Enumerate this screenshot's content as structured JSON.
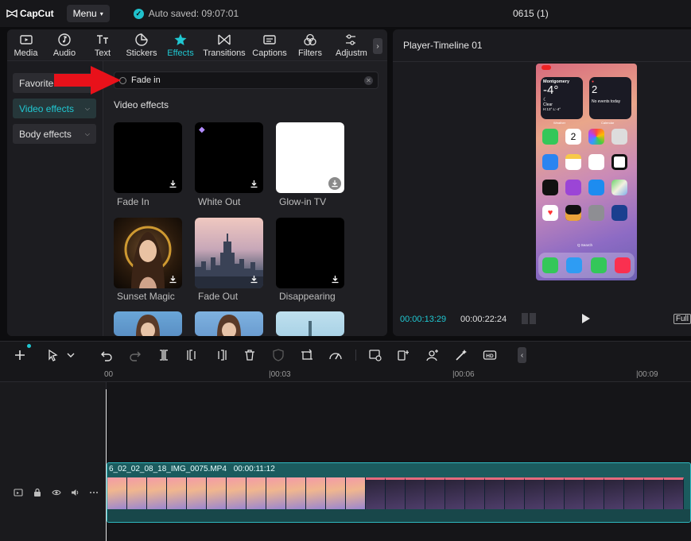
{
  "titlebar": {
    "app_name": "CapCut",
    "menu_label": "Menu",
    "autosave_text": "Auto saved: 09:07:01",
    "project_title": "0615 (1)"
  },
  "tabs": [
    {
      "label": "Media",
      "icon": "media-icon"
    },
    {
      "label": "Audio",
      "icon": "audio-icon"
    },
    {
      "label": "Text",
      "icon": "text-icon"
    },
    {
      "label": "Stickers",
      "icon": "stickers-icon"
    },
    {
      "label": "Effects",
      "icon": "effects-icon",
      "active": true
    },
    {
      "label": "Transitions",
      "icon": "transitions-icon"
    },
    {
      "label": "Captions",
      "icon": "captions-icon"
    },
    {
      "label": "Filters",
      "icon": "filters-icon"
    },
    {
      "label": "Adjustm",
      "icon": "adjustment-icon"
    }
  ],
  "categories": [
    {
      "label": "Favorite"
    },
    {
      "label": "Video effects",
      "active": true
    },
    {
      "label": "Body effects"
    }
  ],
  "search": {
    "value": "Fade in"
  },
  "effects": {
    "section_title": "Video effects",
    "items": [
      {
        "label": "Fade In"
      },
      {
        "label": "White Out"
      },
      {
        "label": "Glow-in TV"
      },
      {
        "label": "Sunset Magic"
      },
      {
        "label": "Fade Out"
      },
      {
        "label": "Disappearing"
      }
    ]
  },
  "player": {
    "title": "Player-Timeline 01",
    "current_time": "00:00:13:29",
    "total_time": "00:00:22:24",
    "full_label": "Full",
    "phone": {
      "weather_city": "Montgomery",
      "weather_temp": "-4°",
      "weather_cond": "Clear",
      "weather_hl": "H:13° L:-4°",
      "cal_day": "2",
      "cal_events": "No events today",
      "weather_widget_label": "Weather",
      "calendar_widget_label": "Calendar",
      "search_label": "Q Search"
    }
  },
  "ruler": {
    "ticks": [
      "00",
      "|00:03",
      "|00:06",
      "|00:09"
    ]
  },
  "clip": {
    "name": "6_02_02_08_18_IMG_0075.MP4",
    "duration": "00:00:11:12"
  },
  "colors": {
    "accent": "#20c8d2",
    "annotation_arrow": "#e8111a"
  }
}
